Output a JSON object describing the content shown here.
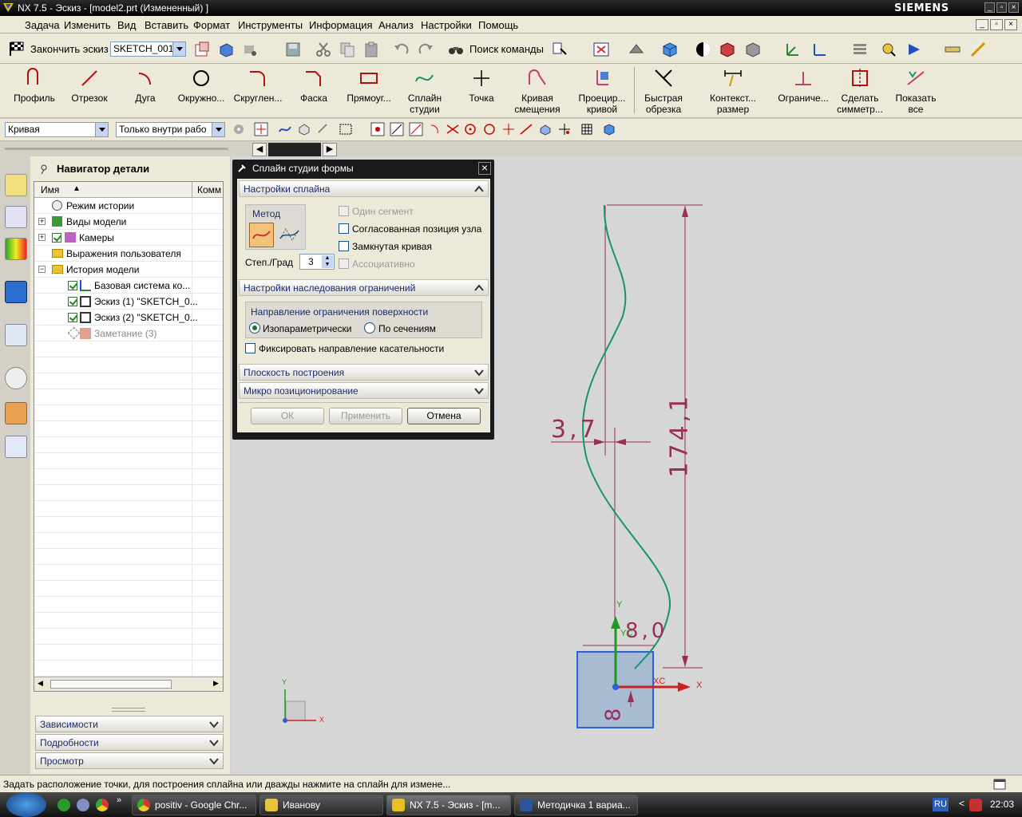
{
  "window": {
    "title": "NX 7.5 - Эскиз - [model2.prt (Измененный) ]",
    "brand": "SIEMENS"
  },
  "menu": [
    "Задача",
    "Изменить",
    "Вид",
    "Вставить",
    "Формат",
    "Инструменты",
    "Информация",
    "Анализ",
    "Настройки",
    "Помощь"
  ],
  "toolbar1": {
    "finish_sketch": "Закончить эскиз",
    "sketch_name": "SKETCH_001",
    "command_search": "Поиск команды"
  },
  "toolbar2": {
    "buttons": [
      "Профиль",
      "Отрезок",
      "Дуга",
      "Окружно...",
      "Скруглен...",
      "Фаска",
      "Прямоуг...",
      "Сплайн студии",
      "Точка",
      "Кривая смещения",
      "Проецир... кривой",
      "Быстрая обрезка",
      "Контекст... размер",
      "Ограниче...",
      "Сделать симметр...",
      "Показать все"
    ]
  },
  "toolbar3": {
    "filter_type": "Кривая",
    "filter_scope": "Только внутри рабо"
  },
  "navigator": {
    "title": "Навигатор детали",
    "col_name": "Имя",
    "col_comment": "Комм",
    "rows": [
      "Режим истории",
      "Виды модели",
      "Камеры",
      "Выражения пользователя",
      "История модели",
      "Базовая система ко...",
      "Эскиз (1) \"SKETCH_0...",
      "Эскиз (2) \"SKETCH_0...",
      "Заметание (3)"
    ],
    "panels": [
      "Зависимости",
      "Подробности",
      "Просмотр"
    ]
  },
  "dialog": {
    "title": "Сплайн студии формы",
    "section_spline": "Настройки сплайна",
    "method_label": "Метод",
    "degree_label": "Степ./Град",
    "degree_value": "3",
    "opt_one_segment": "Один сегмент",
    "opt_matched_knot": "Согласованная позиция узла",
    "opt_closed": "Замкнутая кривая",
    "opt_associative": "Ассоциативно",
    "section_inherit": "Настройки наследования ограничений",
    "surface_dir_label": "Направление ограничения поверхности",
    "radio_iso": "Изопараметрически",
    "radio_sections": "По сечениям",
    "fix_tangent": "Фиксировать направление касательности",
    "section_plane": "Плоскость построения",
    "section_micro": "Микро позиционирование",
    "btn_ok": "ОК",
    "btn_apply": "Применить",
    "btn_cancel": "Отмена"
  },
  "canvas": {
    "dim_width": "3,7",
    "dim_height": "174,1",
    "dim_small1": "8,0",
    "dim_small2": "8",
    "axis_y": "Y",
    "axis_x": "X",
    "axis_yc": "YC",
    "axis_xc": "XC",
    "wcs_y": "Y",
    "wcs_x": "X",
    "spline_color": "#17956a",
    "dim_color": "#9a2e5a"
  },
  "status": "Задать расположение точки, для построения сплайна или дважды нажмите на сплайн для измене...",
  "taskbar": {
    "tasks": [
      "positiv - Google Chr...",
      "Иванову",
      "NX 7.5 - Эскиз - [m...",
      "Методичка 1 вариа..."
    ],
    "lang": "RU",
    "clock": "22:03"
  }
}
